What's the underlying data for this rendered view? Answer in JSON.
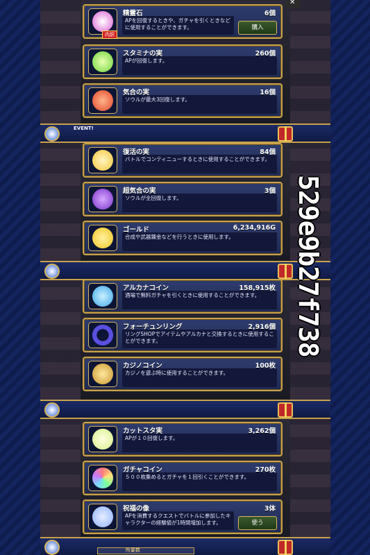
{
  "watermark": "529e9b27f738",
  "seam": {
    "event_label": "EVENT!"
  },
  "bottom_tab": {
    "label": "所要数"
  },
  "items": [
    {
      "name": "精霊石",
      "qty": "6個",
      "desc": "APを回復するときや、ガチャを引くときなどに使用することができます。",
      "button": "購入",
      "tag": "内訳",
      "icon": "crystal-icon",
      "color": "#d95bd0"
    },
    {
      "name": "スタミナの実",
      "qty": "260個",
      "desc": "APが回復します。",
      "icon": "stamina-fruit-icon",
      "color": "#6bd33a"
    },
    {
      "name": "気合の実",
      "qty": "16個",
      "desc": "ソウルが最大3回復します。",
      "icon": "spirit-fruit-icon",
      "color": "#e0462a"
    },
    {
      "name": "復活の実",
      "qty": "84個",
      "desc": "バトルでコンティニューするときに使用することができます。",
      "icon": "revival-fruit-icon",
      "color": "#f2c23a"
    },
    {
      "name": "超気合の実",
      "qty": "3個",
      "desc": "ソウルが全回復します。",
      "icon": "super-spirit-fruit-icon",
      "color": "#7a33c9"
    },
    {
      "name": "ゴールド",
      "qty": "6,234,916G",
      "desc": "合成や武器錬金などを行うときに使用します。",
      "icon": "gold-icon",
      "color": "#f0c420"
    },
    {
      "name": "アルカナコイン",
      "qty": "158,915枚",
      "desc": "酒場で無料ガチャを引くときに使用することができます。",
      "icon": "arcana-coin-icon",
      "color": "#3ea6e8"
    },
    {
      "name": "フォーチュンリング",
      "qty": "2,916個",
      "desc": "リングSHOPでアイテムやアルカナと交換するときに使用することができます。",
      "icon": "fortune-ring-icon",
      "color": "#5a4fe0"
    },
    {
      "name": "カジノコイン",
      "qty": "100枚",
      "desc": "カジノを遊ぶ時に使用することができます。",
      "icon": "casino-coin-icon",
      "color": "#c8962c"
    },
    {
      "name": "カットスタ実",
      "qty": "3,262個",
      "desc": "APが１０回復します。",
      "icon": "cut-fruit-icon",
      "color": "#d6ef8a"
    },
    {
      "name": "ガチャコイン",
      "qty": "270枚",
      "desc": "５００枚集めるとガチャを１回引くことができます。",
      "icon": "gacha-coin-icon",
      "color": "#e6a3ff"
    },
    {
      "name": "祝福の像",
      "qty": "3体",
      "desc": "APを消費するクエストでバトルに参加したキャラクターの経験値が1時間増加します。",
      "button": "使う",
      "icon": "blessing-statue-icon",
      "color": "#8fb2ff"
    }
  ]
}
